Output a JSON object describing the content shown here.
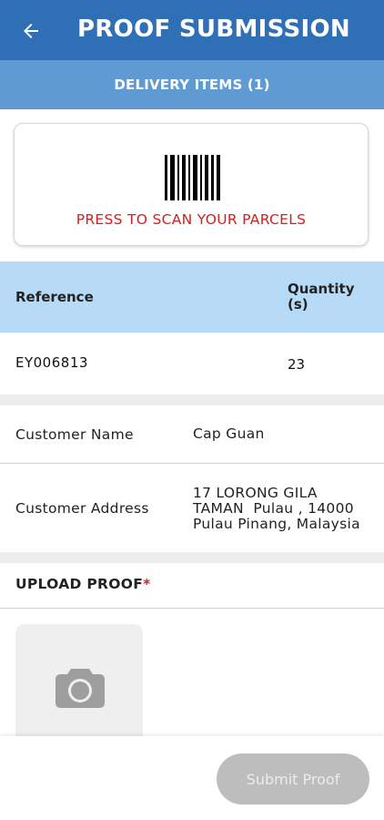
{
  "appbar": {
    "title": "PROOF SUBMISSION",
    "back_icon": "arrow-left-icon"
  },
  "subbar": {
    "label": "DELIVERY ITEMS (1)"
  },
  "scan": {
    "label": "PRESS TO SCAN YOUR PARCELS",
    "icon": "barcode-icon",
    "color": "#d32020"
  },
  "table": {
    "headers": {
      "reference": "Reference",
      "quantity": "Quantity(s)"
    },
    "rows": [
      {
        "reference": "EY006813",
        "quantity": "23"
      }
    ]
  },
  "customer": {
    "name_label": "Customer Name",
    "name": "Cap Guan",
    "address_label": "Customer Address",
    "address_line1": "17 LORONG GILA",
    "address_line2": "TAMAN  Pulau , 14000",
    "address_line3": "Pulau Pinang, Malaysia"
  },
  "upload": {
    "label": "UPLOAD PROOF",
    "required_mark": "*",
    "icon": "camera-icon"
  },
  "footer": {
    "submit_label": "Submit Proof"
  },
  "colors": {
    "primary": "#2f6fb6",
    "sub_header": "#5f9bd2",
    "table_header": "#b7daf7",
    "disabled_button": "#bdbdbd"
  }
}
